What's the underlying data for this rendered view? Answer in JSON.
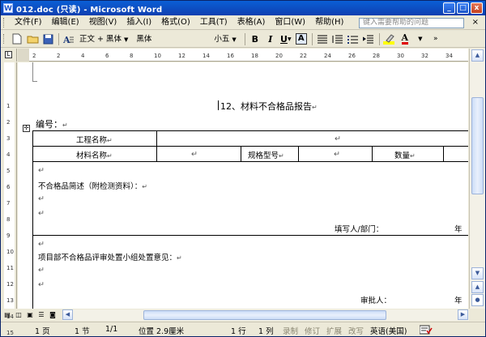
{
  "window": {
    "title": "012.doc (只读) - Microsoft Word",
    "buttons": {
      "min": "_",
      "max": "□",
      "close": "x"
    }
  },
  "menubar": {
    "items": [
      "文件(F)",
      "编辑(E)",
      "视图(V)",
      "插入(I)",
      "格式(O)",
      "工具(T)",
      "表格(A)",
      "窗口(W)",
      "帮助(H)"
    ],
    "help_placeholder": "键入需要帮助的问题",
    "close_doc": "×"
  },
  "toolbar": {
    "style": "正文 + 黑体",
    "font": "黑体",
    "size": "小五",
    "bold": "B",
    "italic": "I",
    "underline": "U",
    "charborder": "A",
    "fontcolor": "A"
  },
  "ruler": {
    "h_ticks": [
      "2",
      "2",
      "4",
      "6",
      "8",
      "10",
      "12",
      "14",
      "16",
      "18",
      "20",
      "22",
      "24",
      "26",
      "28",
      "30",
      "32",
      "34"
    ],
    "v_ticks": [
      "1",
      "2",
      "3",
      "4",
      "5",
      "6",
      "7",
      "8",
      "9",
      "10",
      "11",
      "12",
      "13",
      "14",
      "15"
    ]
  },
  "document": {
    "title": "12、材料不合格品报告",
    "number_label": "编号：",
    "table": {
      "row1_label": "工程名称",
      "row2_labels": [
        "材料名称",
        "规格型号",
        "数量"
      ],
      "section1": "不合格品简述（附检测资料）：",
      "section1_sign": "填写人/部门：",
      "section1_year": "年",
      "section2": "项目部不合格品评审处置小组处置意见：",
      "section2_sign": "审批人：",
      "section2_year": "年"
    },
    "mark": "↵"
  },
  "statusbar": {
    "page": "1 页",
    "section": "1 节",
    "pages": "1/1",
    "position": "位置 2.9厘米",
    "line": "1 行",
    "col": "1 列",
    "rec": "录制",
    "trk": "修订",
    "ext": "扩展",
    "ovr": "改写",
    "lang": "英语(美国)"
  }
}
